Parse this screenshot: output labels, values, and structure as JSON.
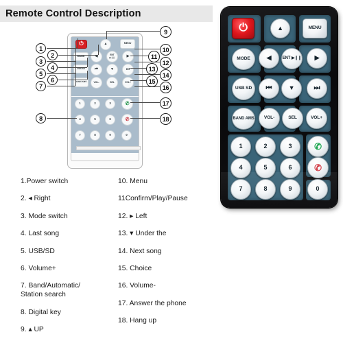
{
  "page_title": "Remote Control Description",
  "diagram": {
    "mini_remote_keys": [
      {
        "name": "power",
        "label": "⏻"
      },
      {
        "name": "mode",
        "label": "MODE"
      },
      {
        "name": "usb-sd",
        "label": "USB\nSD"
      },
      {
        "name": "band-ams",
        "label": "BAND\nAMS"
      },
      {
        "name": "up",
        "label": "▲"
      },
      {
        "name": "menu",
        "label": "MENU"
      },
      {
        "name": "left",
        "label": "◀"
      },
      {
        "name": "ent-play-pause",
        "label": "ENT\n▶❙❙"
      },
      {
        "name": "right",
        "label": "▶"
      },
      {
        "name": "prev-track",
        "label": "⏮"
      },
      {
        "name": "down",
        "label": "▼"
      },
      {
        "name": "next-track",
        "label": "⏭"
      },
      {
        "name": "vol-down",
        "label": "VOL-"
      },
      {
        "name": "sel",
        "label": "SEL"
      },
      {
        "name": "vol-up",
        "label": "VOL+"
      },
      {
        "name": "answer-call",
        "label": "✆"
      },
      {
        "name": "hang-up",
        "label": "✆"
      },
      {
        "name": "digit-1",
        "label": "1"
      },
      {
        "name": "digit-2",
        "label": "2"
      },
      {
        "name": "digit-3",
        "label": "3"
      },
      {
        "name": "digit-4",
        "label": "4"
      },
      {
        "name": "digit-5",
        "label": "5"
      },
      {
        "name": "digit-6",
        "label": "6"
      },
      {
        "name": "digit-7",
        "label": "7"
      },
      {
        "name": "digit-8",
        "label": "8"
      },
      {
        "name": "digit-9",
        "label": "9"
      },
      {
        "name": "digit-0",
        "label": "0"
      }
    ],
    "callouts": [
      {
        "n": "1"
      },
      {
        "n": "2"
      },
      {
        "n": "3"
      },
      {
        "n": "4"
      },
      {
        "n": "5"
      },
      {
        "n": "6"
      },
      {
        "n": "7"
      },
      {
        "n": "8"
      },
      {
        "n": "9"
      },
      {
        "n": "10"
      },
      {
        "n": "11"
      },
      {
        "n": "12"
      },
      {
        "n": "13"
      },
      {
        "n": "14"
      },
      {
        "n": "15"
      },
      {
        "n": "16"
      },
      {
        "n": "17"
      },
      {
        "n": "18"
      }
    ]
  },
  "big_remote": {
    "keys": [
      {
        "name": "power",
        "label": "⏻"
      },
      {
        "name": "up",
        "label": "▲"
      },
      {
        "name": "menu",
        "label": "MENU"
      },
      {
        "name": "mode",
        "label": "MODE"
      },
      {
        "name": "left",
        "label": "◀"
      },
      {
        "name": "ent-play-pause",
        "label": "ENT\n▶❙❙"
      },
      {
        "name": "right",
        "label": "▶"
      },
      {
        "name": "usb-sd",
        "label": "USB\nSD"
      },
      {
        "name": "prev-track",
        "label": "⏮"
      },
      {
        "name": "down",
        "label": "▼"
      },
      {
        "name": "next-track",
        "label": "⏭"
      },
      {
        "name": "band-ams",
        "label": "BAND\nAMS"
      },
      {
        "name": "vol-down",
        "label": "VOL-"
      },
      {
        "name": "sel",
        "label": "SEL"
      },
      {
        "name": "vol-up",
        "label": "VOL+"
      },
      {
        "name": "digit-1",
        "label": "1"
      },
      {
        "name": "digit-2",
        "label": "2"
      },
      {
        "name": "digit-3",
        "label": "3"
      },
      {
        "name": "answer-call",
        "label": "✆"
      },
      {
        "name": "digit-4",
        "label": "4"
      },
      {
        "name": "digit-5",
        "label": "5"
      },
      {
        "name": "digit-6",
        "label": "6"
      },
      {
        "name": "hang-up",
        "label": "✆"
      },
      {
        "name": "digit-7",
        "label": "7"
      },
      {
        "name": "digit-8",
        "label": "8"
      },
      {
        "name": "digit-9",
        "label": "9"
      },
      {
        "name": "digit-0",
        "label": "0"
      }
    ]
  },
  "legend": {
    "left": [
      "1.Power switch",
      "2. ◂ Right",
      "3. Mode switch",
      "4. Last song",
      "5. USB/SD",
      "6. Volume+",
      "7. Band/Automatic/\n    Station search",
      "8. Digital key",
      "9. ▴ UP"
    ],
    "right": [
      "10. Menu",
      "11Confirm/Play/Pause",
      "12. ▸  Left",
      "13. ▾  Under the",
      "14. Next song",
      "15. Choice",
      "16. Volume-",
      "17. Answer the phone",
      "18. Hang up"
    ]
  },
  "colors": {
    "title_band": "#e8e8e8",
    "panel_teal": "#3a6478",
    "power_red": "#e0161c",
    "call_green": "#16a34a",
    "hang_red": "#d23a44",
    "remote_body": "#111113"
  }
}
